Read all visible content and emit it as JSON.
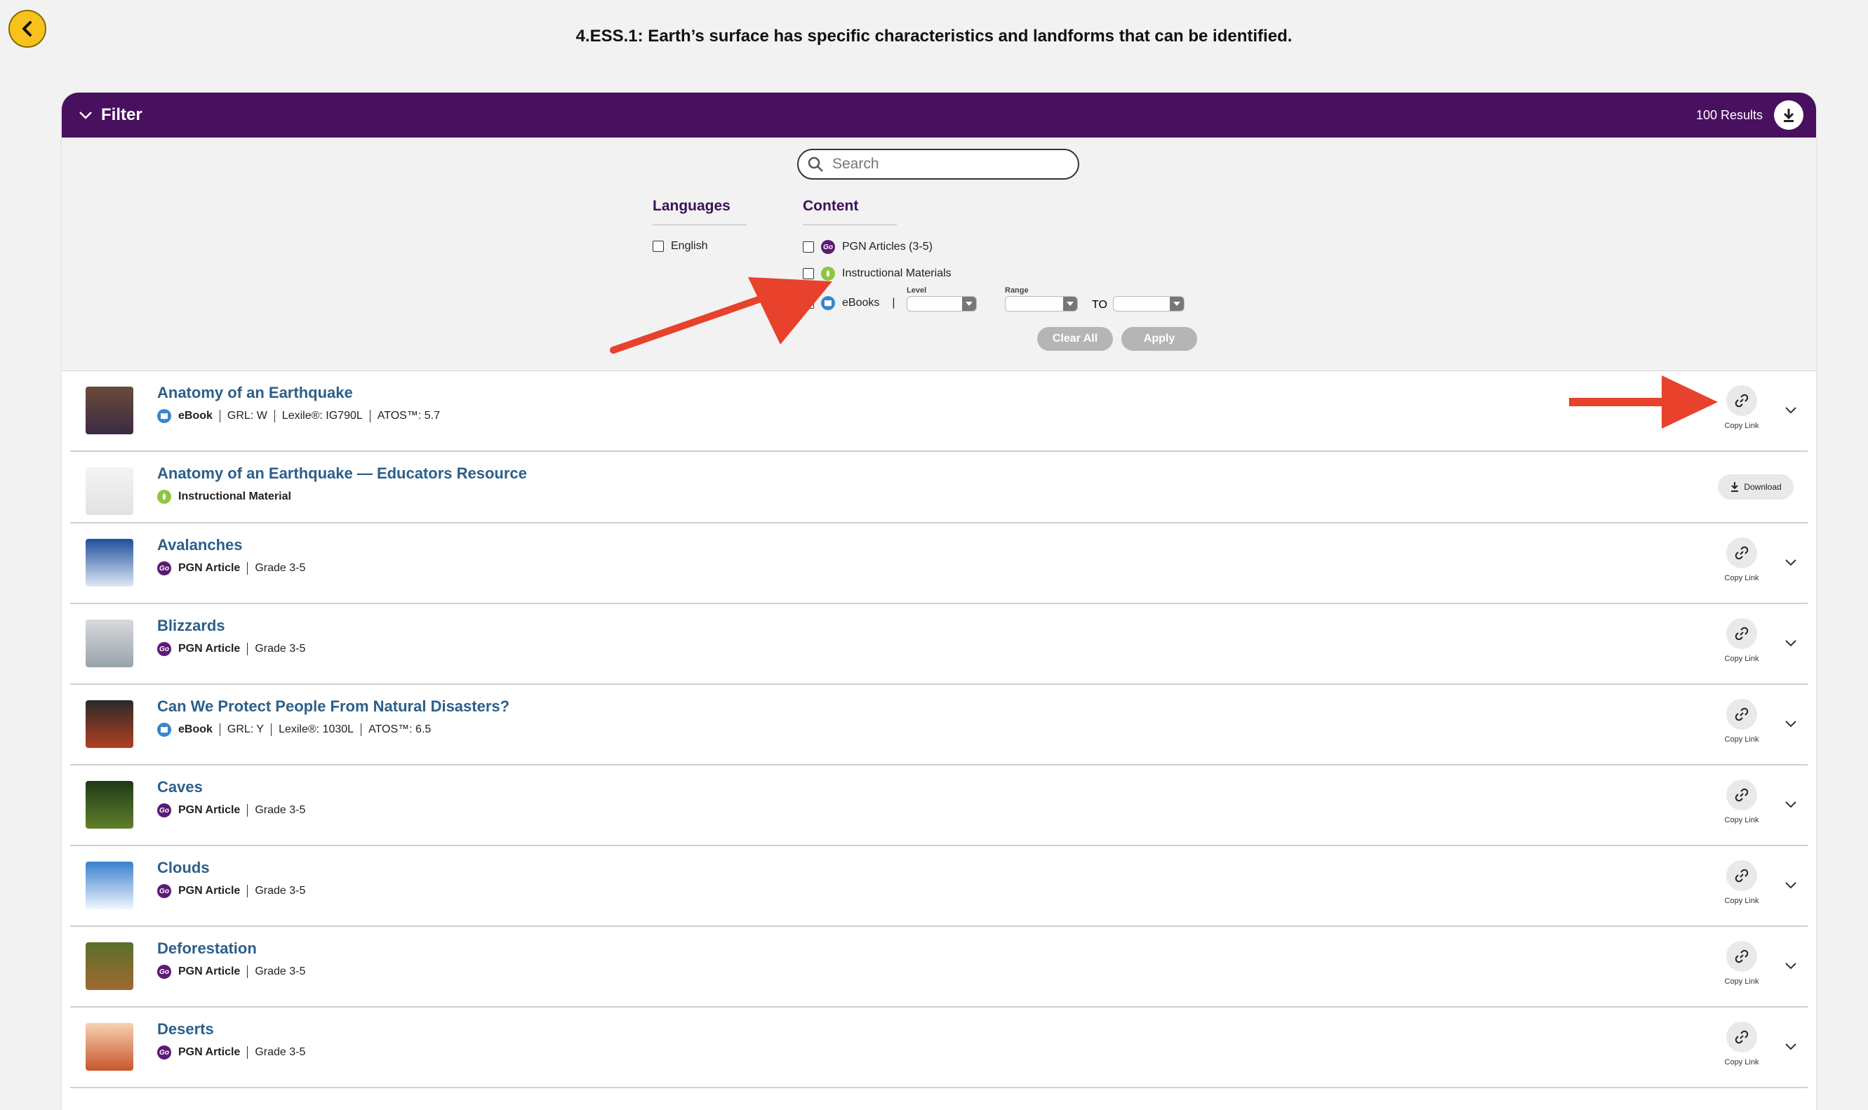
{
  "page_title": "4.ESS.1: Earth’s surface has specific characteristics and landforms that can be identified.",
  "filter": {
    "label": "Filter",
    "results_count": "100 Results",
    "search_placeholder": "Search",
    "languages_heading": "Languages",
    "languages": [
      {
        "label": "English",
        "checked": false
      }
    ],
    "content_heading": "Content",
    "content_options": [
      {
        "label": "PGN Articles (3-5)",
        "badge": "Go",
        "checked": false
      },
      {
        "label": "Instructional Materials",
        "badge": "",
        "checked": false
      },
      {
        "label": "eBooks",
        "badge": "",
        "checked": false
      }
    ],
    "level_label": "Level",
    "range_label": "Range",
    "to_label": "TO",
    "clear_all": "Clear All",
    "apply": "Apply"
  },
  "results": [
    {
      "title": "Anatomy of an Earthquake",
      "type": "eBook",
      "type_badge": "eb",
      "meta": [
        "GRL: W",
        "Lexile®: IG790L",
        "ATOS™: 5.7"
      ],
      "action": "Copy Link"
    },
    {
      "title": "Anatomy of an Earthquake — Educators Resource",
      "type": "Instructional Material",
      "type_badge": "im",
      "meta": [],
      "action": "Download"
    },
    {
      "title": "Avalanches",
      "type": "PGN Article",
      "type_badge": "pgn",
      "meta": [
        "Grade 3-5"
      ],
      "action": "Copy Link"
    },
    {
      "title": "Blizzards",
      "type": "PGN Article",
      "type_badge": "pgn",
      "meta": [
        "Grade 3-5"
      ],
      "action": "Copy Link"
    },
    {
      "title": "Can We Protect People From Natural Disasters?",
      "type": "eBook",
      "type_badge": "eb",
      "meta": [
        "GRL: Y",
        "Lexile®: 1030L",
        "ATOS™: 6.5"
      ],
      "action": "Copy Link"
    },
    {
      "title": "Caves",
      "type": "PGN Article",
      "type_badge": "pgn",
      "meta": [
        "Grade 3-5"
      ],
      "action": "Copy Link"
    },
    {
      "title": "Clouds",
      "type": "PGN Article",
      "type_badge": "pgn",
      "meta": [
        "Grade 3-5"
      ],
      "action": "Copy Link"
    },
    {
      "title": "Deforestation",
      "type": "PGN Article",
      "type_badge": "pgn",
      "meta": [
        "Grade 3-5"
      ],
      "action": "Copy Link"
    },
    {
      "title": "Deserts",
      "type": "PGN Article",
      "type_badge": "pgn",
      "meta": [
        "Grade 3-5"
      ],
      "action": "Copy Link"
    }
  ],
  "colors": {
    "header": "#48105f",
    "link": "#2c5f8a",
    "back": "#f7c21b",
    "arrow": "#e8412c"
  }
}
